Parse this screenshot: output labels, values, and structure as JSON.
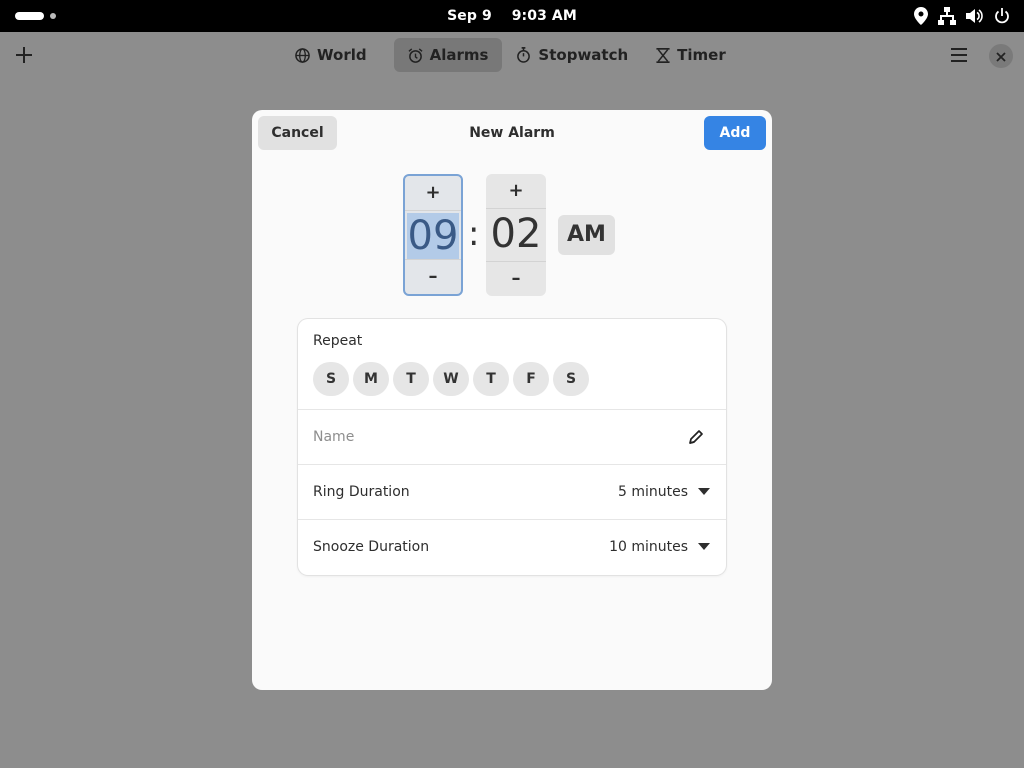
{
  "topbar": {
    "date": "Sep 9",
    "time": "9:03 AM",
    "icons": [
      "location-icon",
      "network-icon",
      "volume-icon",
      "power-icon"
    ]
  },
  "header": {
    "new_icon": "plus-icon",
    "tabs": [
      {
        "label": "World",
        "icon": "globe-icon",
        "active": false
      },
      {
        "label": "Alarms",
        "icon": "alarm-clock-icon",
        "active": true
      },
      {
        "label": "Stopwatch",
        "icon": "stopwatch-icon",
        "active": false
      },
      {
        "label": "Timer",
        "icon": "hourglass-icon",
        "active": false
      }
    ],
    "menu_icon": "hamburger-menu-icon",
    "close_icon": "close-icon"
  },
  "dialog": {
    "cancel_label": "Cancel",
    "title": "New Alarm",
    "add_label": "Add",
    "time": {
      "hour": "09",
      "minute": "02",
      "separator": ":",
      "increment": "+",
      "decrement": "–",
      "period": "AM"
    },
    "repeat": {
      "label": "Repeat",
      "days": [
        "S",
        "M",
        "T",
        "W",
        "T",
        "F",
        "S"
      ]
    },
    "name": {
      "placeholder": "Name",
      "value": ""
    },
    "ring_duration": {
      "label": "Ring Duration",
      "value": "5 minutes"
    },
    "snooze_duration": {
      "label": "Snooze Duration",
      "value": "10 minutes"
    }
  },
  "colors": {
    "accent": "#3584e4",
    "backdrop": "#8d8d8d",
    "dialog_bg": "#fafafa",
    "focus_border": "#7aa3d5"
  }
}
